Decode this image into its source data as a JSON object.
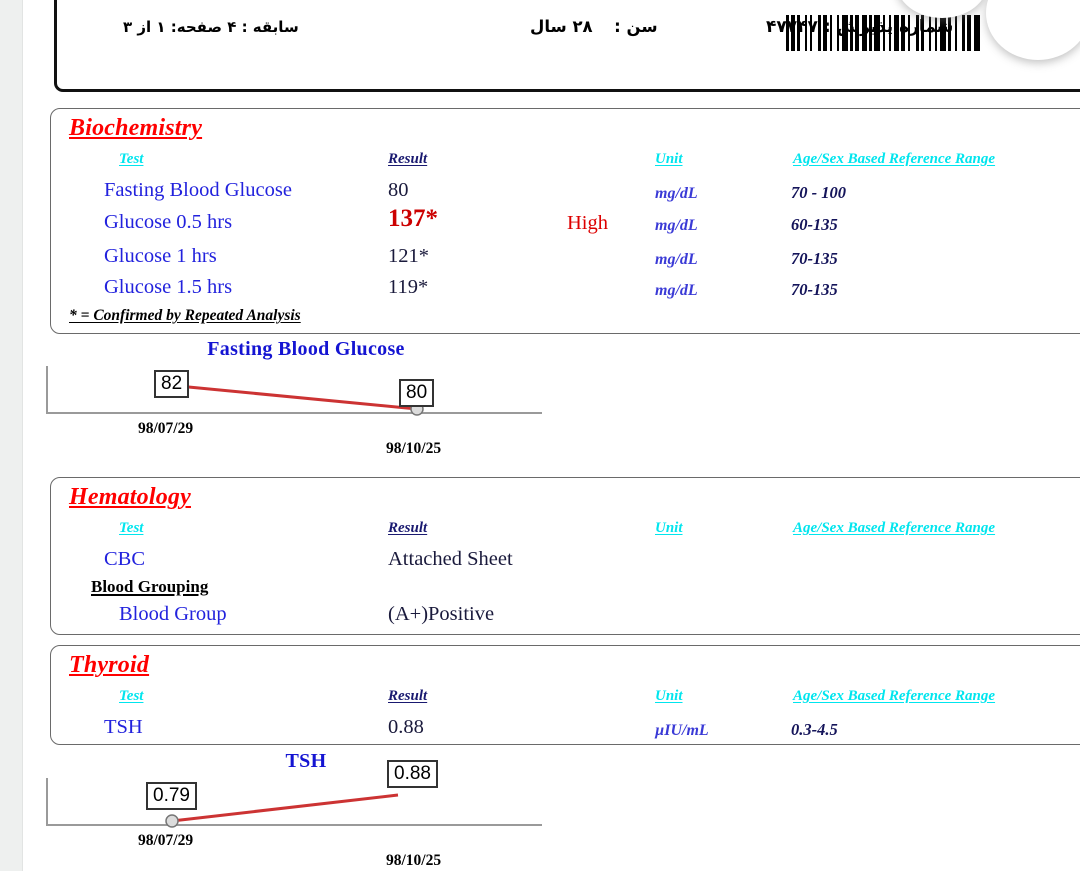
{
  "header": {
    "admission_label": "شماره پذیرش :",
    "admission_number": "۴۷۷۴۷",
    "age_label": "سن :",
    "age_value": "۲۸ سال",
    "history_page": "سابقه : ۴   صفحه: ۱  از   ۳",
    "barcode_name": "barcode"
  },
  "columns": {
    "test": "Test",
    "result": "Result",
    "unit": "Unit",
    "range": "Age/Sex Based Reference Range"
  },
  "sections": [
    {
      "id": "biochemistry",
      "title": "Biochemistry",
      "rows": [
        {
          "test": "Fasting Blood Glucose",
          "result": "80",
          "flag": "",
          "unit": "mg/dL",
          "range": "70 - 100"
        },
        {
          "test": "Glucose 0.5 hrs",
          "result": "137*",
          "flag": "High",
          "unit": "mg/dL",
          "range": "60-135"
        },
        {
          "test": "Glucose 1 hrs",
          "result": "121*",
          "flag": "",
          "unit": "mg/dL",
          "range": "70-135"
        },
        {
          "test": "Glucose 1.5 hrs",
          "result": "119*",
          "flag": "",
          "unit": "mg/dL",
          "range": "70-135"
        }
      ],
      "footnote": "* = Confirmed by Repeated Analysis"
    },
    {
      "id": "hematology",
      "title": "Hematology",
      "rows": [
        {
          "test": "CBC",
          "result": "Attached Sheet",
          "flag": "",
          "unit": "",
          "range": ""
        },
        {
          "test": "Blood Group",
          "result": "(A+)Positive",
          "flag": "",
          "unit": "",
          "range": ""
        }
      ],
      "subheading": "Blood Grouping"
    },
    {
      "id": "thyroid",
      "title": "Thyroid",
      "rows": [
        {
          "test": "TSH",
          "result": "0.88",
          "flag": "",
          "unit": "µIU/mL",
          "range": "0.3-4.5"
        }
      ]
    }
  ],
  "chart_data": [
    {
      "type": "line",
      "title": "Fasting Blood Glucose",
      "x": [
        "98/07/29",
        "98/10/25"
      ],
      "values": [
        82,
        80
      ],
      "point_labels": [
        "82",
        "80"
      ],
      "xlabel": "",
      "ylabel": "",
      "grid": false,
      "line_color": "#cc3333",
      "marker_color": "#d9d9d9"
    },
    {
      "type": "line",
      "title": "TSH",
      "x": [
        "98/07/29",
        "98/10/25"
      ],
      "values": [
        0.79,
        0.88
      ],
      "point_labels": [
        "0.79",
        "0.88"
      ],
      "xlabel": "",
      "ylabel": "",
      "grid": false,
      "line_color": "#cc3333",
      "marker_color": "#d9d9d9"
    }
  ],
  "colors": {
    "section_title": "#ff0000",
    "column_header": "#00e5ee",
    "test_name": "#2222dd",
    "flag_high": "#dd0000",
    "reference_range": "#14145a",
    "trend_line": "#cc3333"
  }
}
